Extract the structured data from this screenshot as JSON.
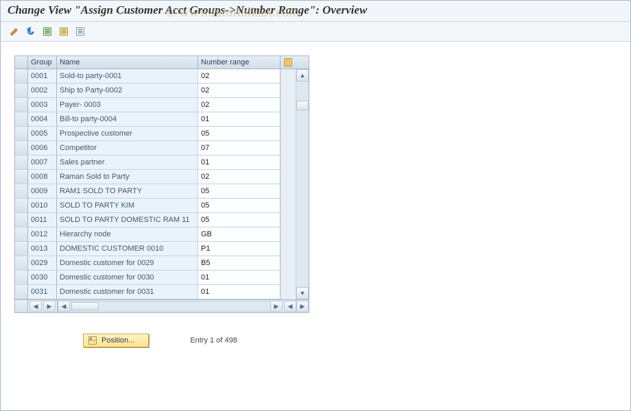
{
  "title": "Change View \"Assign Customer Acct Groups->Number Range\": Overview",
  "watermark": "© www.tutorialkart.com",
  "toolbar": [
    {
      "name": "edit-icon"
    },
    {
      "name": "undo-icon"
    },
    {
      "name": "select-all-icon"
    },
    {
      "name": "select-block-icon"
    },
    {
      "name": "deselect-all-icon"
    }
  ],
  "columns": {
    "group": "Group",
    "name": "Name",
    "range": "Number range"
  },
  "rows": [
    {
      "group": "0001",
      "name": "Sold-to party-0001",
      "range": "02"
    },
    {
      "group": "0002",
      "name": "Ship to Party-0002",
      "range": "02"
    },
    {
      "group": "0003",
      "name": "Payer- 0003",
      "range": "02"
    },
    {
      "group": "0004",
      "name": "Bill-to party-0004",
      "range": "01"
    },
    {
      "group": "0005",
      "name": "Prospective customer",
      "range": "05"
    },
    {
      "group": "0006",
      "name": "Competitor",
      "range": "07"
    },
    {
      "group": "0007",
      "name": "Sales partner",
      "range": "01"
    },
    {
      "group": "0008",
      "name": "Raman Sold to Party",
      "range": "02"
    },
    {
      "group": "0009",
      "name": "RAM1 SOLD TO PARTY",
      "range": "05"
    },
    {
      "group": "0010",
      "name": "SOLD TO PARTY KIM",
      "range": "05"
    },
    {
      "group": "0011",
      "name": "SOLD TO PARTY DOMESTIC RAM 11",
      "range": "05"
    },
    {
      "group": "0012",
      "name": "Hierarchy node",
      "range": "GB"
    },
    {
      "group": "0013",
      "name": "DOMESTIC CUSTOMER 0010",
      "range": "P1"
    },
    {
      "group": "0029",
      "name": "Domestic customer for  0029",
      "range": "B5"
    },
    {
      "group": "0030",
      "name": "Domestic customer for  0030",
      "range": "01"
    },
    {
      "group": "0031",
      "name": "Domestic customer for  0031",
      "range": "01"
    }
  ],
  "footer": {
    "position_label": "Position...",
    "entry_text": "Entry 1 of 498"
  }
}
